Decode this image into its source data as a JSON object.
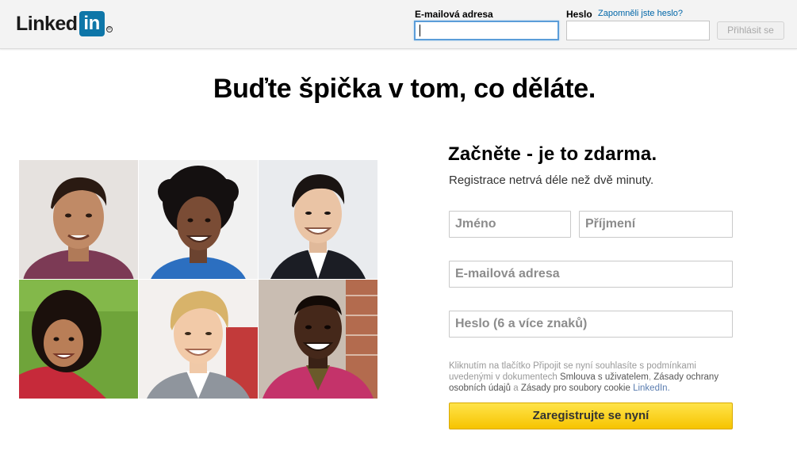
{
  "header": {
    "logo_text": "Linked",
    "logo_box": "in",
    "logo_reg": "®",
    "email_label": "E-mailová adresa",
    "password_label": "Heslo",
    "forgot_link": "Zapomněli jste heslo?",
    "login_button": "Přihlásit se",
    "email_value": "",
    "password_value": ""
  },
  "headline": "Buďte špička v tom, co děláte.",
  "photos": [
    {
      "name": "photo-man-smiling"
    },
    {
      "name": "photo-woman-curly-hair"
    },
    {
      "name": "photo-man-suit"
    },
    {
      "name": "photo-woman-grass"
    },
    {
      "name": "photo-man-blond"
    },
    {
      "name": "photo-man-pink-jacket"
    }
  ],
  "signup": {
    "title": "Začněte - je to zdarma.",
    "subtitle": "Registrace netrvá déle než dvě minuty.",
    "first_name_placeholder": "Jméno",
    "last_name_placeholder": "Příjmení",
    "email_placeholder": "E-mailová adresa",
    "password_placeholder": "Heslo (6 a více znaků)",
    "terms_prefix": "Kliknutím na tlačítko Připojit se nyní souhlasíte s podmínkami uvedenými v dokumentech ",
    "terms_link1": "Smlouva s uživatelem",
    "terms_sep1": ", ",
    "terms_link2": "Zásady ochrany osobních údajů",
    "terms_sep2": " a ",
    "terms_link3": "Zásady pro soubory cookie",
    "terms_suffix": " LinkedIn.",
    "register_button": "Zaregistrujte se nyní"
  },
  "colors": {
    "brand_blue": "#0e76a8",
    "register_yellow": "#f6c400",
    "link_blue": "#0066a8"
  }
}
